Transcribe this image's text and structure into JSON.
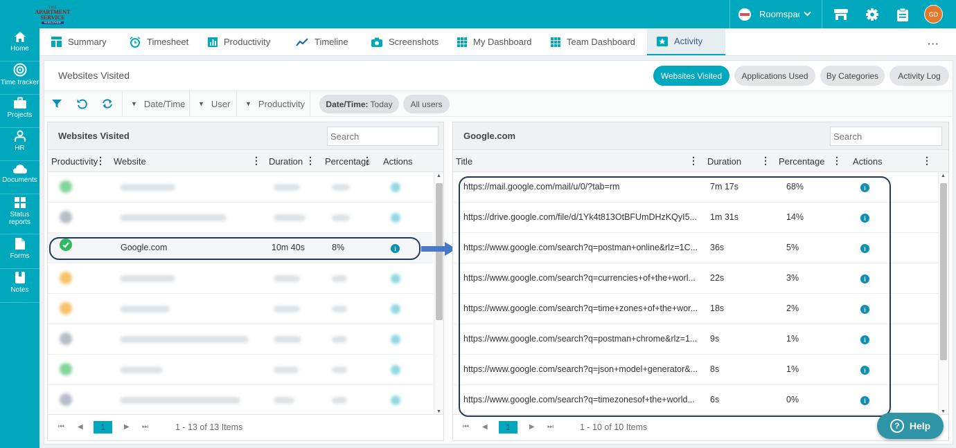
{
  "header": {
    "logo": {
      "line1": "THE",
      "line2": "APARTMENT",
      "line3": "SERVICE",
      "line4": "WORLDWIDE"
    },
    "company": "Roomspac",
    "avatar": "GD",
    "icons": [
      "store-icon",
      "gear-icon",
      "clipboard-icon"
    ]
  },
  "sidebar": {
    "items": [
      {
        "label": "Home",
        "icon": "home-icon"
      },
      {
        "label": "Time tracker",
        "icon": "time-tracker-icon"
      },
      {
        "label": "Projects",
        "icon": "briefcase-icon"
      },
      {
        "label": "HR",
        "icon": "person-icon"
      },
      {
        "label": "Documents",
        "icon": "cloud-icon"
      },
      {
        "label": "Status reports",
        "icon": "grid-icon"
      },
      {
        "label": "Forms",
        "icon": "form-icon"
      },
      {
        "label": "Notes",
        "icon": "note-icon"
      }
    ]
  },
  "tabs": [
    {
      "label": "Summary",
      "icon": "layout-icon"
    },
    {
      "label": "Timesheet",
      "icon": "alarm-icon"
    },
    {
      "label": "Productivity",
      "icon": "bar-chart-icon"
    },
    {
      "label": "Timeline",
      "icon": "trend-icon"
    },
    {
      "label": "Screenshots",
      "icon": "camera-icon"
    },
    {
      "label": "My Dashboard",
      "icon": "dashboard-icon"
    },
    {
      "label": "Team Dashboard",
      "icon": "dashboard-icon"
    },
    {
      "label": "Activity",
      "icon": "star-icon",
      "active": true
    }
  ],
  "page": {
    "title": "Websites Visited",
    "view_buttons": [
      "Websites Visited",
      "Applications Used",
      "By Categories",
      "Activity Log"
    ],
    "active_view": "Websites Visited"
  },
  "toolbar": {
    "filters": [
      "Date/Time",
      "User",
      "Productivity"
    ],
    "chips": [
      {
        "key": "Date/Time:",
        "value": "Today"
      },
      {
        "key": "",
        "value": "All users"
      }
    ]
  },
  "left_panel": {
    "title": "Websites Visited",
    "search_placeholder": "Search",
    "columns": [
      "Productivity",
      "Website",
      "Duration",
      "Percentage",
      "Actions"
    ],
    "highlighted_row": {
      "website": "Google.com",
      "duration": "10m 40s",
      "percentage": "8%",
      "productivity": "productive"
    },
    "blurred_row_colors": [
      "#7fd49a",
      "#b9bcc9",
      "#7fd49a",
      "#f7c26b",
      "#f7c26b",
      "#b9bcc9",
      "#7fd49a",
      "#b9bcc9"
    ],
    "pager": {
      "page": "1",
      "info": "1 - 13 of 13 Items"
    }
  },
  "right_panel": {
    "title": "Google.com",
    "search_placeholder": "Search",
    "columns": [
      "Title",
      "Duration",
      "Percentage",
      "Actions"
    ],
    "rows": [
      {
        "title": "https://mail.google.com/mail/u/0/?tab=rm",
        "duration": "7m 17s",
        "percentage": "68%"
      },
      {
        "title": "https://drive.google.com/file/d/1Yk4t813OtBFUmDHzKQyI5...",
        "duration": "1m 31s",
        "percentage": "14%"
      },
      {
        "title": "https://www.google.com/search?q=postman+online&rlz=1C...",
        "duration": "36s",
        "percentage": "5%"
      },
      {
        "title": "https://www.google.com/search?q=currencies+of+the+worl...",
        "duration": "22s",
        "percentage": "3%"
      },
      {
        "title": "https://www.google.com/search?q=time+zones+of+the+wor...",
        "duration": "18s",
        "percentage": "2%"
      },
      {
        "title": "https://www.google.com/search?q=postman+chrome&rlz=1...",
        "duration": "9s",
        "percentage": "1%"
      },
      {
        "title": "https://www.google.com/search?q=json+model+generator&...",
        "duration": "8s",
        "percentage": "1%"
      },
      {
        "title": "https://www.google.com/search?q=timezonesof+the+world...",
        "duration": "6s",
        "percentage": "0%"
      }
    ],
    "pager": {
      "page": "1",
      "info": "1 - 10 of 10 Items"
    }
  },
  "help": {
    "label": "Help"
  },
  "colors": {
    "accent": "#00a8bd",
    "outline": "#1f3b5b",
    "arrow": "#4a78c8",
    "info": "#0e8fb5"
  }
}
